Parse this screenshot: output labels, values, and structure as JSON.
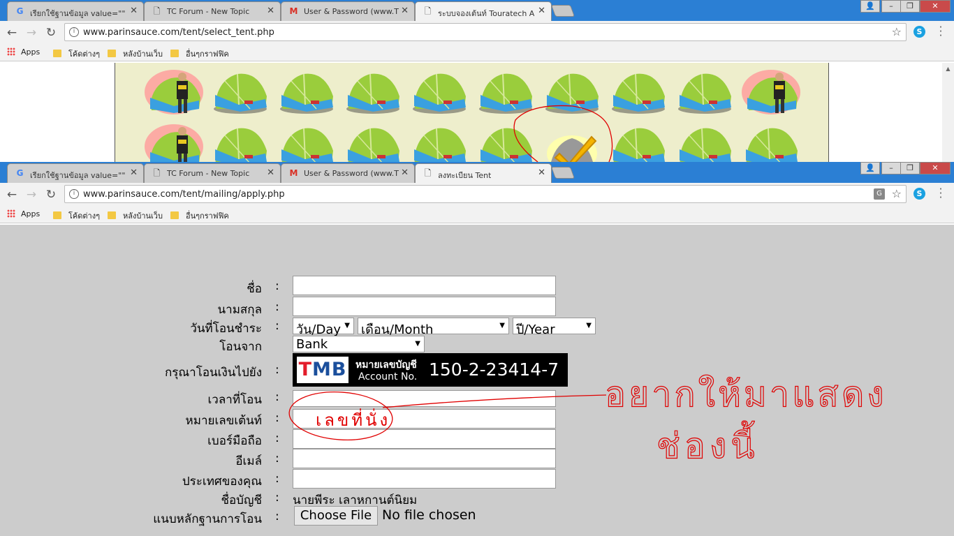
{
  "top_window": {
    "tabs": [
      {
        "label": "เรียกใช้ฐานข้อมูล value=\"\"",
        "icon": "google-icon"
      },
      {
        "label": "TC Forum - New Topic",
        "icon": "page-icon"
      },
      {
        "label": "User & Password (www.T",
        "icon": "gmail-icon"
      },
      {
        "label": "ระบบจองเต้นท์ Touratech A",
        "icon": "page-icon",
        "active": true
      }
    ],
    "url": "www.parinsauce.com/tent/select_tent.php",
    "bookmarks": [
      "Apps",
      "โค้ดต่างๆ",
      "หลังบ้านเว็บ",
      "อื่นๆกราฟฟิค"
    ]
  },
  "bottom_window": {
    "tabs": [
      {
        "label": "เรียกใช้ฐานข้อมูล value=\"\"",
        "icon": "google-icon"
      },
      {
        "label": "TC Forum - New Topic",
        "icon": "page-icon"
      },
      {
        "label": "User & Password (www.T",
        "icon": "gmail-icon"
      },
      {
        "label": "ลงทะเบียน Tent",
        "icon": "page-icon",
        "active": true
      }
    ],
    "url": "www.parinsauce.com/tent/mailing/apply.php",
    "bookmarks": [
      "Apps",
      "โค้ดต่างๆ",
      "หลังบ้านเว็บ",
      "อื่นๆกราฟฟิค"
    ]
  },
  "form": {
    "colon": ":",
    "labels": {
      "name": "ชื่อ",
      "surname": "นามสกุล",
      "transfer_date": "วันที่โอนชำระ",
      "transfer_from": "โอนจาก",
      "transfer_to": "กรุณาโอนเงินไปยัง",
      "transfer_time": "เวลาที่โอน",
      "tent_number": "หมายเลขเต้นท์",
      "mobile": "เบอร์มือถือ",
      "email": "อีเมล์",
      "country": "ประเทศของคุณ",
      "account_name": "ชื่อบัญชี",
      "attach_proof": "แนบหลักฐานการโอน"
    },
    "day_select": "วัน/Day",
    "month_select": "เดือน/Month",
    "year_select": "ปี/Year",
    "bank_select": "Bank",
    "account_name_value": "นายพีระ เลาหกานต์นิยม",
    "file_button": "Choose File",
    "file_status": "No file chosen"
  },
  "bank_banner": {
    "logo_text": "TMB",
    "label_th": "หมายเลขบัญชี",
    "label_en": "Account No.",
    "account_number": "150-2-23414-7"
  },
  "annotation_notes": {
    "circled_text": "เลขที่นั่ง",
    "note_line1": "อยากให้มาแสดง",
    "note_line2": "ช่องนี้"
  },
  "colors": {
    "tab_bar": "#2b7fd4",
    "form_bg": "#cccccc",
    "tent_panel_bg": "#eeeecc",
    "annotation_red": "#e00000",
    "tmb_blue": "#1b4f9c",
    "tmb_red": "#e31d2b"
  }
}
